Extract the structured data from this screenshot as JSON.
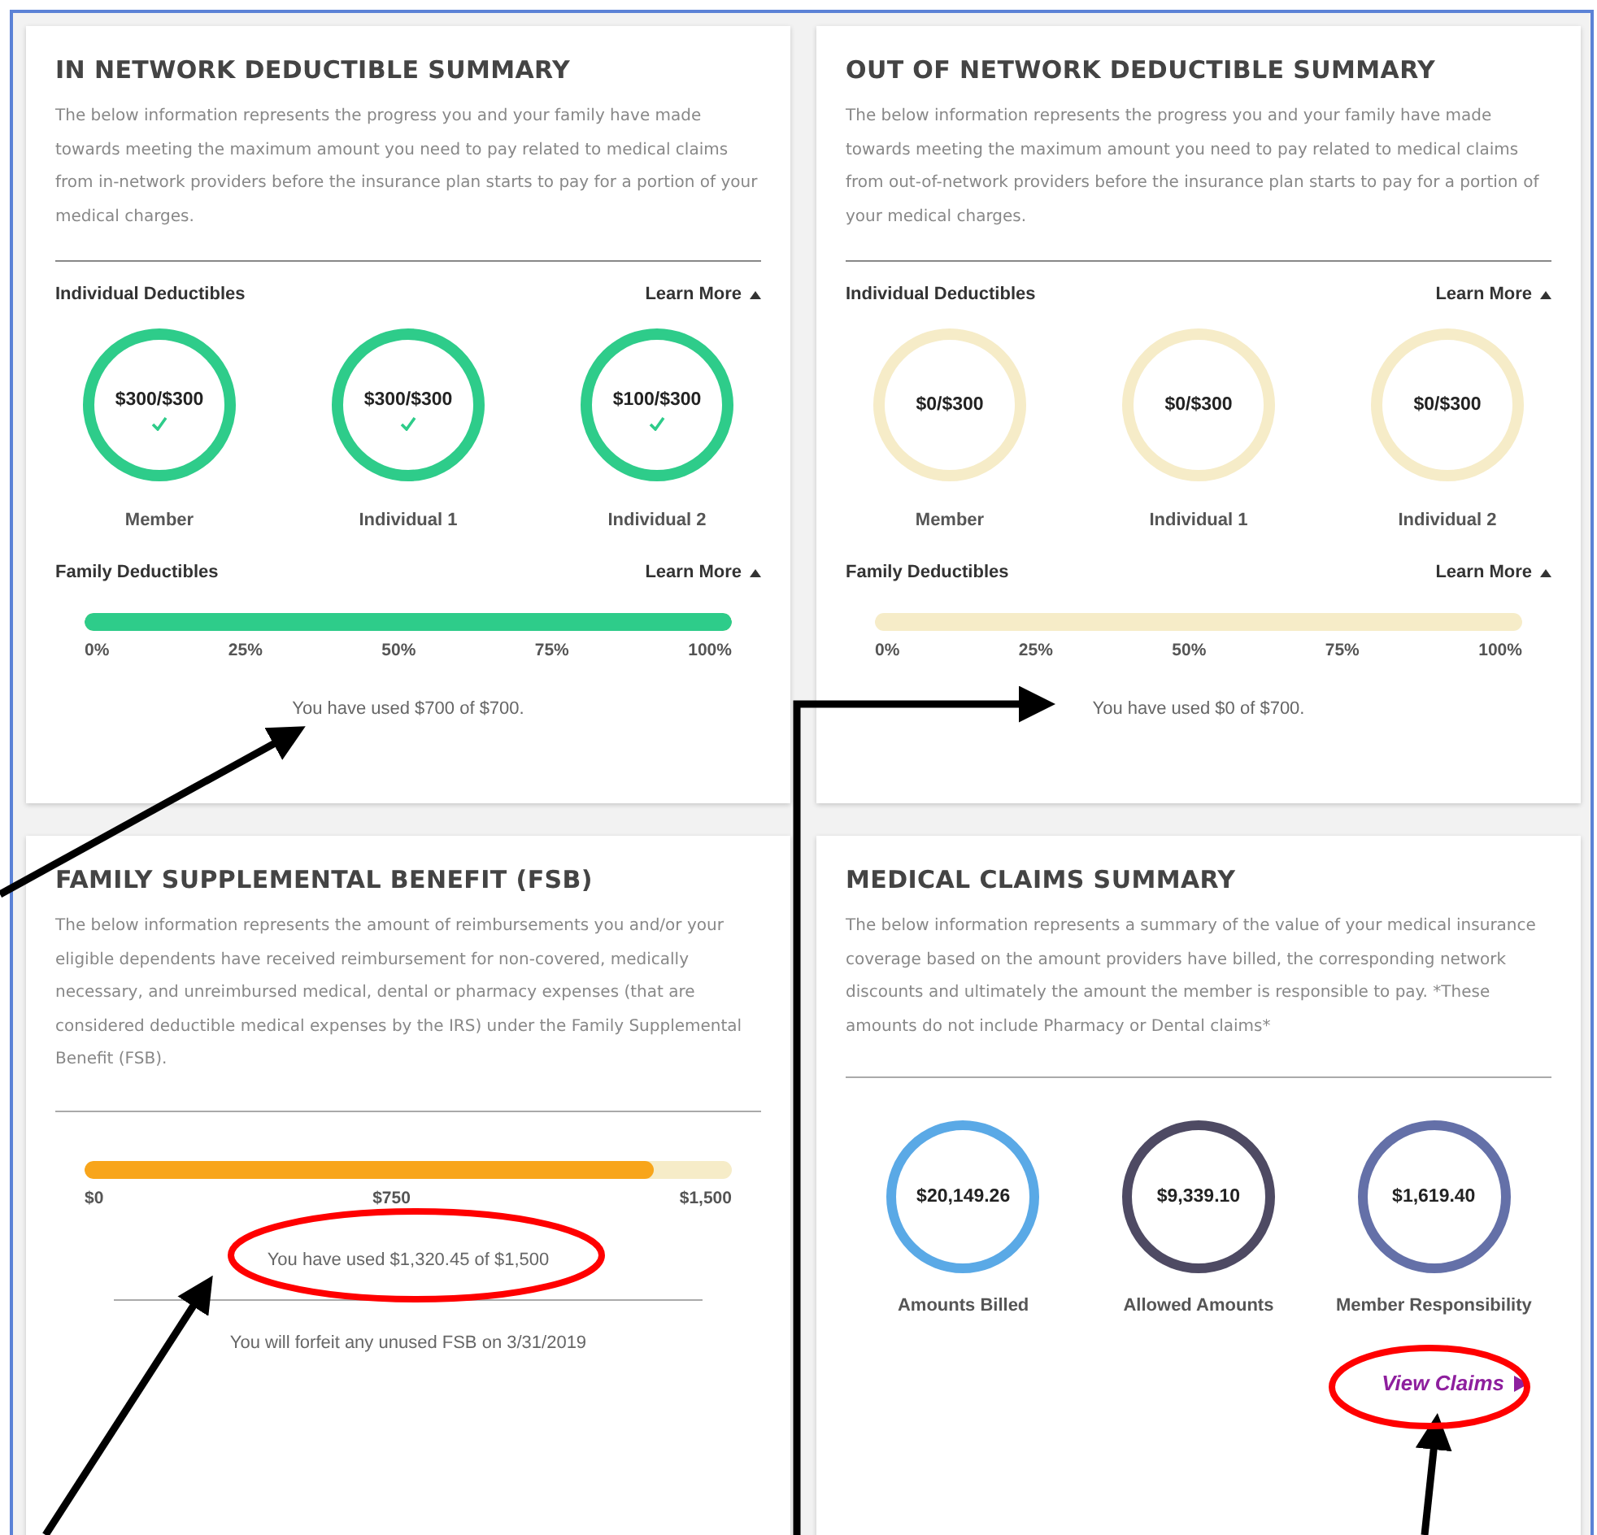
{
  "deductible_cards": [
    {
      "title": "IN NETWORK DEDUCTIBLE SUMMARY",
      "description": "The below information represents the progress you and your family have made towards meeting the maximum amount you need to pay related to medical claims from in-network providers before the insurance plan starts to pay for a portion of your medical charges.",
      "individual_heading": "Individual Deductibles",
      "learn_more": "Learn More",
      "individuals": [
        {
          "amount": "$300/$300",
          "name": "Member",
          "met": true
        },
        {
          "amount": "$300/$300",
          "name": "Individual 1",
          "met": true
        },
        {
          "amount": "$100/$300",
          "name": "Individual 2",
          "met": true
        }
      ],
      "family_heading": "Family Deductibles",
      "family_learn_more": "Learn More",
      "family_bar": {
        "level": 1
      },
      "ticks": [
        "0%",
        "25%",
        "50%",
        "75%",
        "100%"
      ],
      "used_text": "You have used $700 of $700."
    },
    {
      "title": "OUT OF NETWORK DEDUCTIBLE SUMMARY",
      "description": "The below information represents the progress you and your family have made towards meeting the maximum amount you need to pay related to medical claims from out-of-network providers before the insurance plan starts to pay for a portion of your medical charges.",
      "individual_heading": "Individual Deductibles",
      "learn_more": "Learn More",
      "individuals": [
        {
          "amount": "$0/$300",
          "name": "Member",
          "met": false
        },
        {
          "amount": "$0/$300",
          "name": "Individual 1",
          "met": false
        },
        {
          "amount": "$0/$300",
          "name": "Individual 2",
          "met": false
        }
      ],
      "family_heading": "Family Deductibles",
      "family_learn_more": "Learn More",
      "ticks": [
        "0%",
        "25%",
        "50%",
        "75%",
        "100%"
      ],
      "used_text": "You have used $0 of $700."
    }
  ],
  "fsb": {
    "title": "FAMILY SUPPLEMENTAL BENEFIT (FSB)",
    "description": "The below information represents the amount of reimbursements you and/or your eligible dependents have received reimbursement for non-covered, medically necessary, and unreimbursed medical, dental or pharmacy expenses (that are considered deductible medical expenses by the IRS) under the Family Supplemental Benefit (FSB).",
    "level": 0.88,
    "ticks": [
      "$0",
      "$750",
      "$1,500"
    ],
    "used_text": "You have used $1,320.45 of $1,500",
    "forfeit_text": "You will forfeit any unused FSB on 3/31/2019"
  },
  "claims": {
    "title": "MEDICAL CLAIMS SUMMARY",
    "description": "The below information represents a summary of the value of your medical insurance coverage based on the amount providers have billed, the corresponding network discounts and ultimately the amount the member is responsible to pay. *These amounts do not include Pharmacy or Dental claims*",
    "items": [
      {
        "amount": "$20,149.26",
        "label": "Amounts Billed",
        "color": "#5aa9e6"
      },
      {
        "amount": "$9,339.10",
        "label": "Allowed Amounts",
        "color": "#4e4a63"
      },
      {
        "amount": "$1,619.40",
        "label": "Member Responsibility",
        "color": "#6470a8"
      }
    ],
    "link": "View Claims"
  }
}
